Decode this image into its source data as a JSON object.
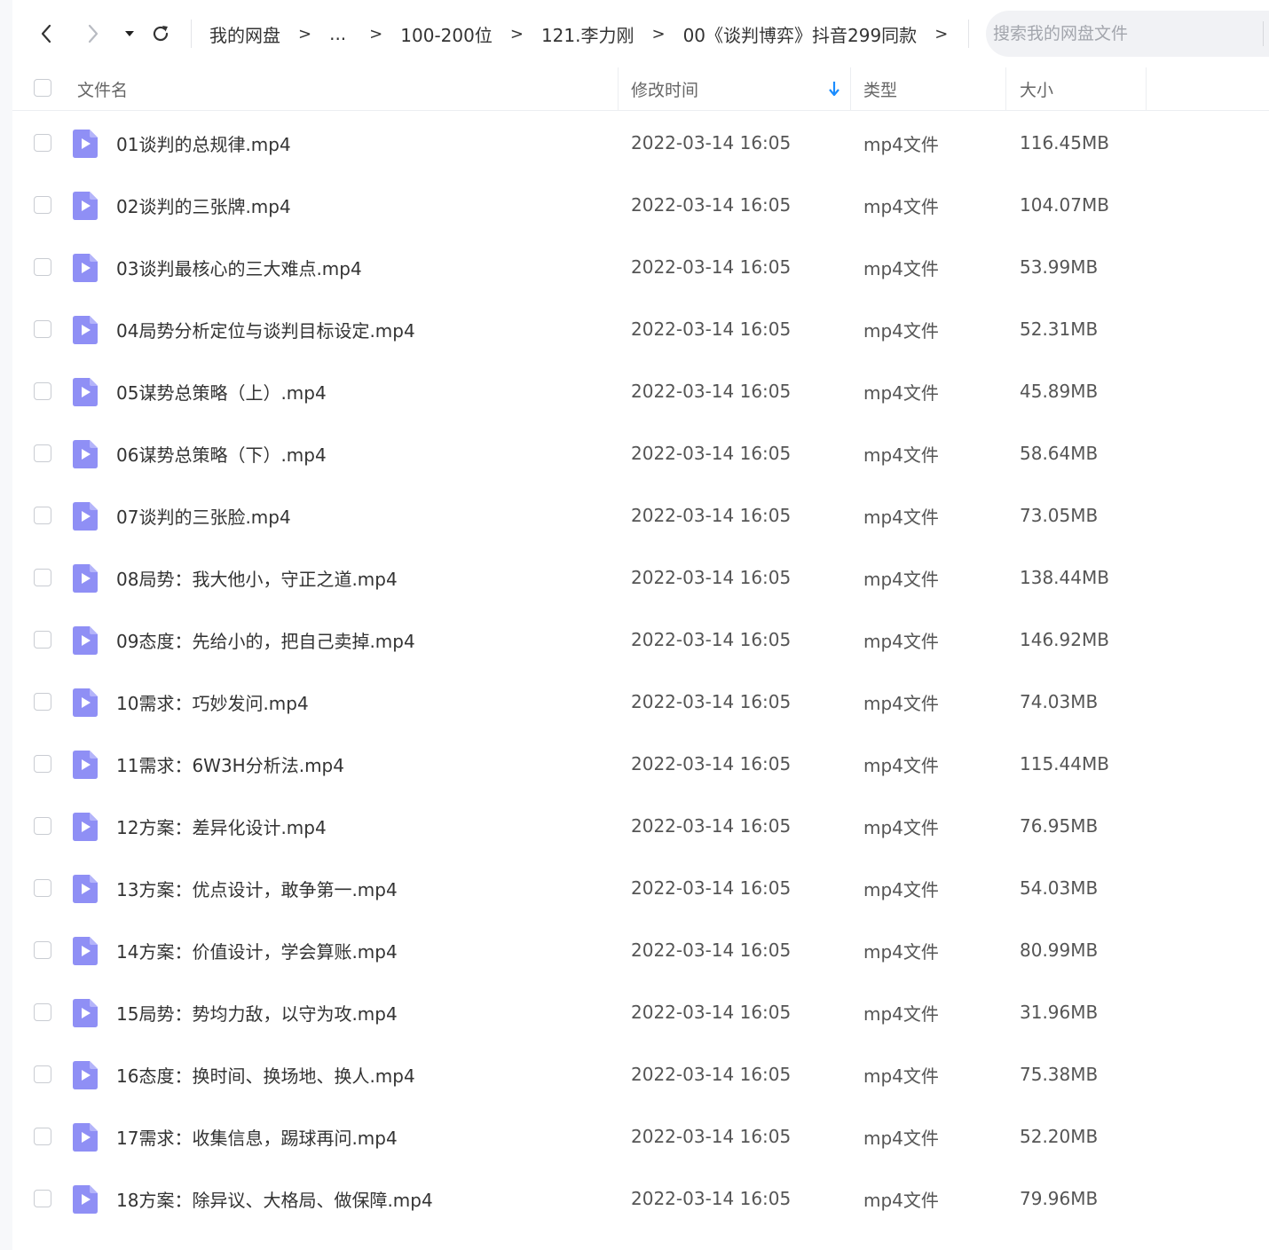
{
  "toolbar": {
    "breadcrumbs": [
      "我的网盘",
      "...",
      "100-200位",
      "121.李力刚",
      "00《谈判博弈》抖音299同款"
    ],
    "separator": ">",
    "search_placeholder": "搜索我的网盘文件"
  },
  "table": {
    "headers": {
      "name": "文件名",
      "modified": "修改时间",
      "type": "类型",
      "size": "大小"
    },
    "sort": {
      "column": "modified",
      "direction": "desc"
    },
    "rows": [
      {
        "name": "01谈判的总规律.mp4",
        "modified": "2022-03-14 16:05",
        "type": "mp4文件",
        "size": "116.45MB"
      },
      {
        "name": "02谈判的三张牌.mp4",
        "modified": "2022-03-14 16:05",
        "type": "mp4文件",
        "size": "104.07MB"
      },
      {
        "name": "03谈判最核心的三大难点.mp4",
        "modified": "2022-03-14 16:05",
        "type": "mp4文件",
        "size": "53.99MB"
      },
      {
        "name": "04局势分析定位与谈判目标设定.mp4",
        "modified": "2022-03-14 16:05",
        "type": "mp4文件",
        "size": "52.31MB"
      },
      {
        "name": "05谋势总策略（上）.mp4",
        "modified": "2022-03-14 16:05",
        "type": "mp4文件",
        "size": "45.89MB"
      },
      {
        "name": "06谋势总策略（下）.mp4",
        "modified": "2022-03-14 16:05",
        "type": "mp4文件",
        "size": "58.64MB"
      },
      {
        "name": "07谈判的三张脸.mp4",
        "modified": "2022-03-14 16:05",
        "type": "mp4文件",
        "size": "73.05MB"
      },
      {
        "name": "08局势：我大他小，守正之道.mp4",
        "modified": "2022-03-14 16:05",
        "type": "mp4文件",
        "size": "138.44MB"
      },
      {
        "name": "09态度：先给小的，把自己卖掉.mp4",
        "modified": "2022-03-14 16:05",
        "type": "mp4文件",
        "size": "146.92MB"
      },
      {
        "name": "10需求：巧妙发问.mp4",
        "modified": "2022-03-14 16:05",
        "type": "mp4文件",
        "size": "74.03MB"
      },
      {
        "name": "11需求：6W3H分析法.mp4",
        "modified": "2022-03-14 16:05",
        "type": "mp4文件",
        "size": "115.44MB"
      },
      {
        "name": "12方案：差异化设计.mp4",
        "modified": "2022-03-14 16:05",
        "type": "mp4文件",
        "size": "76.95MB"
      },
      {
        "name": "13方案：优点设计，敢争第一.mp4",
        "modified": "2022-03-14 16:05",
        "type": "mp4文件",
        "size": "54.03MB"
      },
      {
        "name": "14方案：价值设计，学会算账.mp4",
        "modified": "2022-03-14 16:05",
        "type": "mp4文件",
        "size": "80.99MB"
      },
      {
        "name": "15局势：势均力敌，以守为攻.mp4",
        "modified": "2022-03-14 16:05",
        "type": "mp4文件",
        "size": "31.96MB"
      },
      {
        "name": "16态度：换时间、换场地、换人.mp4",
        "modified": "2022-03-14 16:05",
        "type": "mp4文件",
        "size": "75.38MB"
      },
      {
        "name": "17需求：收集信息，踢球再问.mp4",
        "modified": "2022-03-14 16:05",
        "type": "mp4文件",
        "size": "52.20MB"
      },
      {
        "name": "18方案：除异议、大格局、做保障.mp4",
        "modified": "2022-03-14 16:05",
        "type": "mp4文件",
        "size": "79.96MB"
      }
    ]
  },
  "icons": {
    "back": "chevron-left-icon",
    "forward": "chevron-right-icon",
    "history": "caret-down-icon",
    "refresh": "refresh-icon",
    "file": "video-file-icon",
    "sort": "arrow-down-icon"
  },
  "colors": {
    "file_icon": "#8f8ff5",
    "sort_arrow": "#1a8cff",
    "search_bg": "#f1f2f5"
  }
}
